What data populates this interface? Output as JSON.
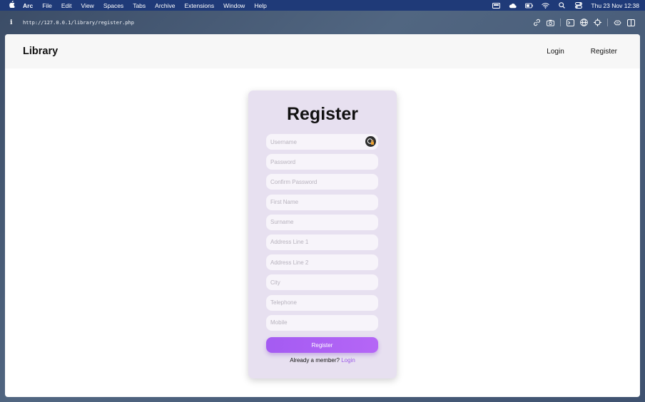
{
  "menubar": {
    "app_name": "Arc",
    "menus": [
      "File",
      "Edit",
      "View",
      "Spaces",
      "Tabs",
      "Archive",
      "Extensions",
      "Window",
      "Help"
    ],
    "clock": "Thu 23 Nov  12:38"
  },
  "browser": {
    "url": "http://127.0.0.1/library/register.php"
  },
  "navbar": {
    "brand": "Library",
    "links": [
      "Login",
      "Register"
    ]
  },
  "form": {
    "title": "Register",
    "fields": [
      {
        "placeholder": "Username"
      },
      {
        "placeholder": "Password"
      },
      {
        "placeholder": "Confirm Password"
      },
      {
        "placeholder": "First Name"
      },
      {
        "placeholder": "Surname"
      },
      {
        "placeholder": "Address Line 1"
      },
      {
        "placeholder": "Address Line 2"
      },
      {
        "placeholder": "City"
      },
      {
        "placeholder": "Telephone"
      },
      {
        "placeholder": "Mobile"
      }
    ],
    "submit_label": "Register",
    "footer_text": "Already a member?",
    "footer_link": "Login"
  },
  "colors": {
    "accent": "#a45bf2",
    "card": "#e7e0f0",
    "menubar": "#1f3a78"
  }
}
